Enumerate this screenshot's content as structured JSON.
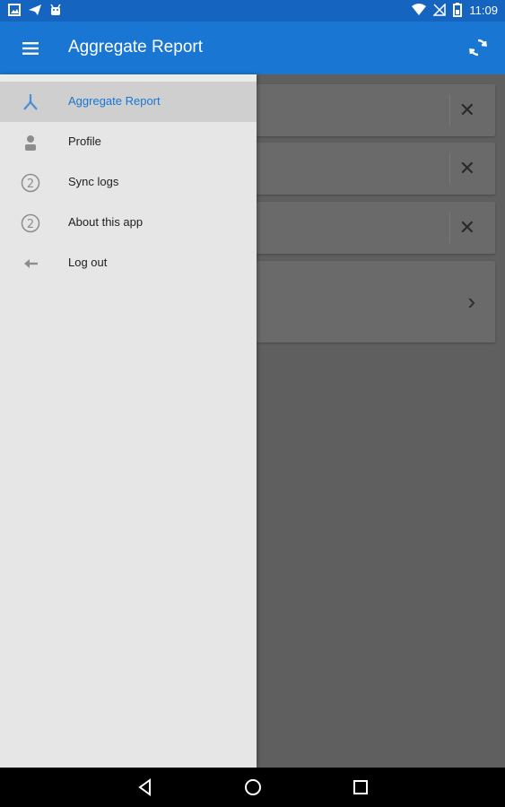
{
  "status_bar": {
    "time": "11:09",
    "left_icons": [
      "image-icon",
      "send-icon",
      "android-icon"
    ],
    "right_icons": [
      "wifi-icon",
      "no-signal-icon",
      "battery-icon"
    ]
  },
  "app_bar": {
    "title": "Aggregate Report",
    "menu_icon": "menu-icon",
    "action_icon": "sync-icon",
    "color": "#1976d2"
  },
  "drawer": {
    "items": [
      {
        "label": "Aggregate Report",
        "icon": "aggregate-icon",
        "active": true
      },
      {
        "label": "Profile",
        "icon": "profile-icon"
      },
      {
        "label": "Sync logs",
        "icon": "two-circle-icon"
      },
      {
        "label": "About this app",
        "icon": "two-circle-icon"
      },
      {
        "label": "Log out",
        "icon": "back-arrow-icon"
      }
    ]
  },
  "background_cards": [
    {
      "action": "close-icon"
    },
    {
      "action": "close-icon"
    },
    {
      "action": "close-icon"
    },
    {
      "action": "chevron-right-icon"
    }
  ],
  "nav_bar": {
    "buttons": [
      "back-triangle-icon",
      "home-circle-icon",
      "recents-square-icon"
    ]
  }
}
